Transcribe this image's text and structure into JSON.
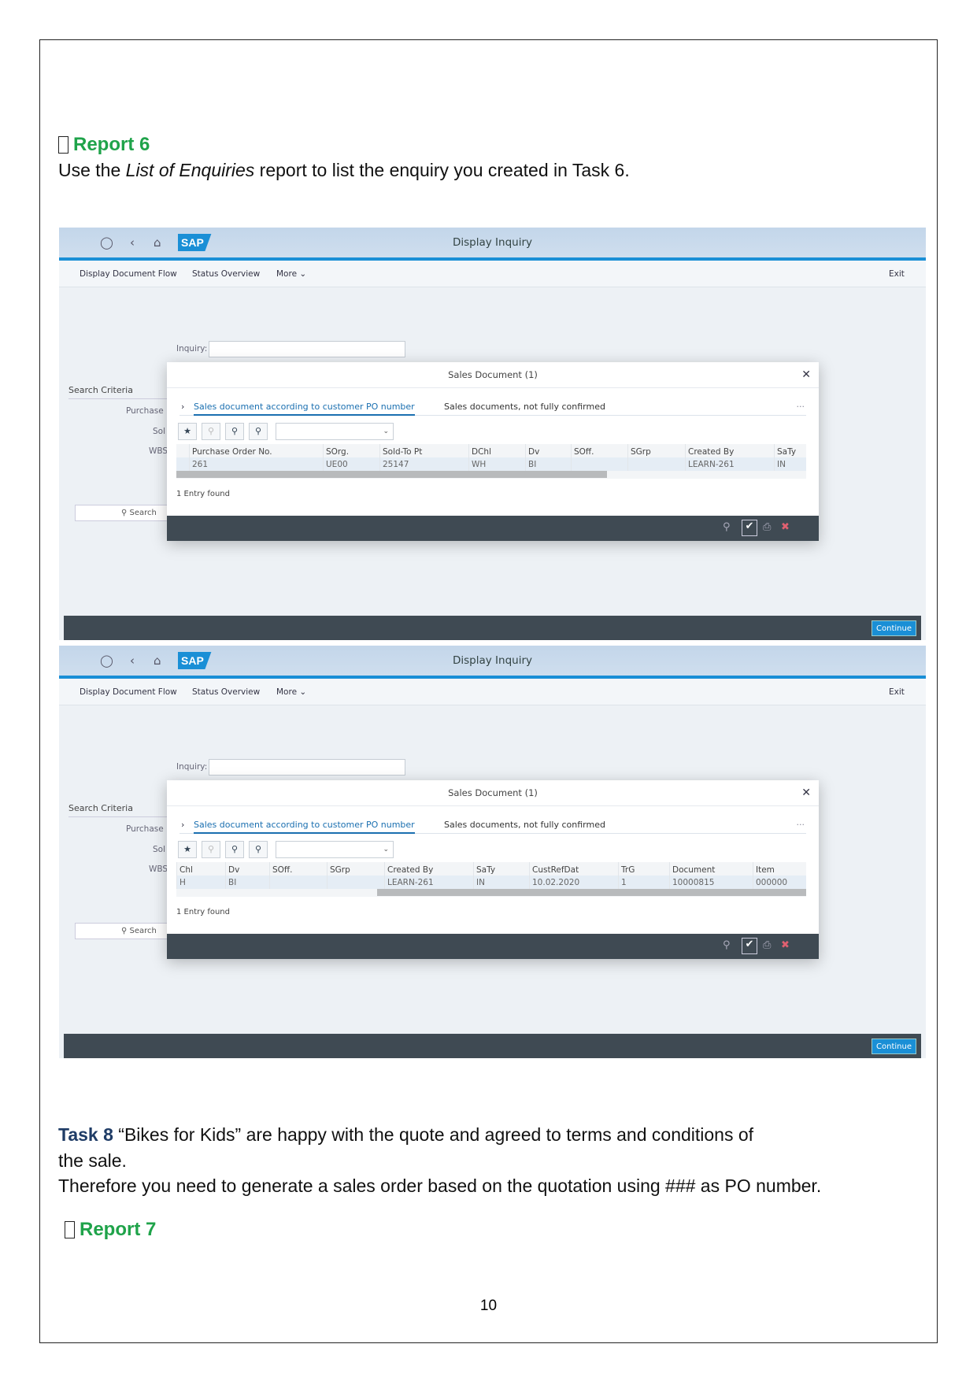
{
  "report6": {
    "label": "Report 6"
  },
  "intro": {
    "pre": "Use the ",
    "em": "List of Enquiries",
    "post": " report to list the enquiry you created in Task 6."
  },
  "screens": [
    {
      "title": "Display Inquiry",
      "toolbar": [
        "Display Document Flow",
        "Status Overview",
        "More"
      ],
      "exit": "Exit",
      "inquiry_label": "Inquiry:",
      "search_criteria": "Search Criteria",
      "fields": [
        "Purchase",
        "Sol",
        "WBS"
      ],
      "search_button": "Search",
      "dialog": {
        "title": "Sales Document (1)",
        "tabs": [
          "Sales document according to customer PO number",
          "Sales documents, not fully confirmed"
        ],
        "columns": [
          {
            "h": "Purchase Order No.",
            "v": "261"
          },
          {
            "h": "SOrg.",
            "v": "UE00"
          },
          {
            "h": "Sold-To Pt",
            "v": "25147"
          },
          {
            "h": "DChl",
            "v": "WH"
          },
          {
            "h": "Dv",
            "v": "BI"
          },
          {
            "h": "SOff.",
            "v": ""
          },
          {
            "h": "SGrp",
            "v": ""
          },
          {
            "h": "Created By",
            "v": "LEARN-261"
          },
          {
            "h": "SaTy",
            "v": "IN"
          }
        ],
        "scroll_position": 0.0,
        "found": "1 Entry found"
      },
      "continue": "Continue"
    },
    {
      "title": "Display Inquiry",
      "toolbar": [
        "Display Document Flow",
        "Status Overview",
        "More"
      ],
      "exit": "Exit",
      "inquiry_label": "Inquiry:",
      "search_criteria": "Search Criteria",
      "fields": [
        "Purchase",
        "Sol",
        "WBS"
      ],
      "search_button": "Search",
      "dialog": {
        "title": "Sales Document (1)",
        "tabs": [
          "Sales document according to customer PO number",
          "Sales documents, not fully confirmed"
        ],
        "columns": [
          {
            "h": "Chl",
            "v": "H"
          },
          {
            "h": "Dv",
            "v": "BI"
          },
          {
            "h": "SOff.",
            "v": ""
          },
          {
            "h": "SGrp",
            "v": ""
          },
          {
            "h": "Created By",
            "v": "LEARN-261"
          },
          {
            "h": "SaTy",
            "v": "IN"
          },
          {
            "h": "CustRefDat",
            "v": "10.02.2020"
          },
          {
            "h": "TrG",
            "v": "1"
          },
          {
            "h": "Document",
            "v": "10000815"
          },
          {
            "h": "Item",
            "v": "000000"
          }
        ],
        "scroll_position": 1.0,
        "found": "1 Entry found"
      },
      "continue": "Continue"
    }
  ],
  "task8": {
    "label": "Task 8",
    "line1": " “Bikes for Kids” are happy with the quote and agreed to terms and conditions of",
    "line2": "the sale.",
    "line3": "Therefore you need to generate a sales order based on the quotation using ### as PO number."
  },
  "report7": {
    "label": "Report 7"
  },
  "page_number": "10",
  "colors": {
    "accent": "#1a8fd6",
    "report": "#1fa34a",
    "task": "#1f3c66",
    "footer": "#3f4a53"
  }
}
